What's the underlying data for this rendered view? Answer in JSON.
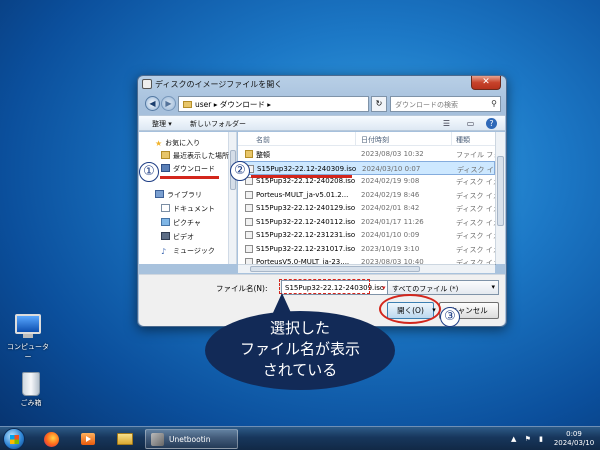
{
  "desktop": {
    "icons": [
      {
        "label": "コンピューター",
        "icon": "computer-icon"
      },
      {
        "label": "ごみ箱",
        "icon": "recycle-bin-icon"
      }
    ]
  },
  "dialog": {
    "title": "ディスクのイメージファイルを開く",
    "close_label": "✕",
    "address": {
      "path": "user ▸ ダウンロード ▸",
      "search_placeholder": "ダウンロードの検索"
    },
    "toolbar": {
      "organize_label": "整理 ▾",
      "new_folder_label": "新しいフォルダー"
    },
    "nav_pane": {
      "favorites_label": "お気に入り",
      "recent_label": "最近表示した場所",
      "downloads_label": "ダウンロード",
      "libraries_label": "ライブラリ",
      "documents_label": "ドキュメント",
      "pictures_label": "ピクチャ",
      "videos_label": "ビデオ",
      "music_label": "ミュージック"
    },
    "columns": {
      "name": "名前",
      "date": "日付時刻",
      "type": "種類"
    },
    "files": [
      {
        "name": "整頓",
        "date": "2023/08/03 10:32",
        "type": "ファイル フォ",
        "kind": "folder"
      },
      {
        "name": "S15Pup32-22.12-240309.iso",
        "date": "2024/03/10 0:07",
        "type": "ディスク イメ",
        "kind": "iso"
      },
      {
        "name": "S15Pup32-22.12-240208.iso",
        "date": "2024/02/19 9:08",
        "type": "ディスク イメ",
        "kind": "iso"
      },
      {
        "name": "Porteus-MULT_ja-v5.01.2...",
        "date": "2024/02/19 8:46",
        "type": "ディスク イメ",
        "kind": "iso"
      },
      {
        "name": "S15Pup32-22.12-240129.iso",
        "date": "2024/02/01 8:42",
        "type": "ディスク イメ",
        "kind": "iso"
      },
      {
        "name": "S15Pup32-22.12-240112.iso",
        "date": "2024/01/17 11:26",
        "type": "ディスク イメ",
        "kind": "iso"
      },
      {
        "name": "S15Pup32-22.12-231231.iso",
        "date": "2024/01/10 0:09",
        "type": "ディスク イメ",
        "kind": "iso"
      },
      {
        "name": "S15Pup32-22.12-231017.iso",
        "date": "2023/10/19 3:10",
        "type": "ディスク イメ",
        "kind": "iso"
      },
      {
        "name": "PorteusV5.0-MULT_ja-23....",
        "date": "2023/08/03 10:40",
        "type": "ディスク イメ",
        "kind": "iso"
      }
    ],
    "selected_file": "S15Pup32-22.12-240309.iso",
    "filename_label": "ファイル名(N):",
    "filename_value": "S15Pup32-22.12-240309.iso",
    "filetype_value": "すべてのファイル (*)",
    "open_label": "開く(O)",
    "cancel_label": "キャンセル"
  },
  "annotations": {
    "step1": "①",
    "step2": "②",
    "step3": "③",
    "callout": "選択した\nファイル名が表示\nされている",
    "accent_color": "#d3261c",
    "callout_color": "#122a57"
  },
  "taskbar": {
    "active_app": "Unetbootin",
    "time": "0:09",
    "date": "2024/03/10"
  }
}
